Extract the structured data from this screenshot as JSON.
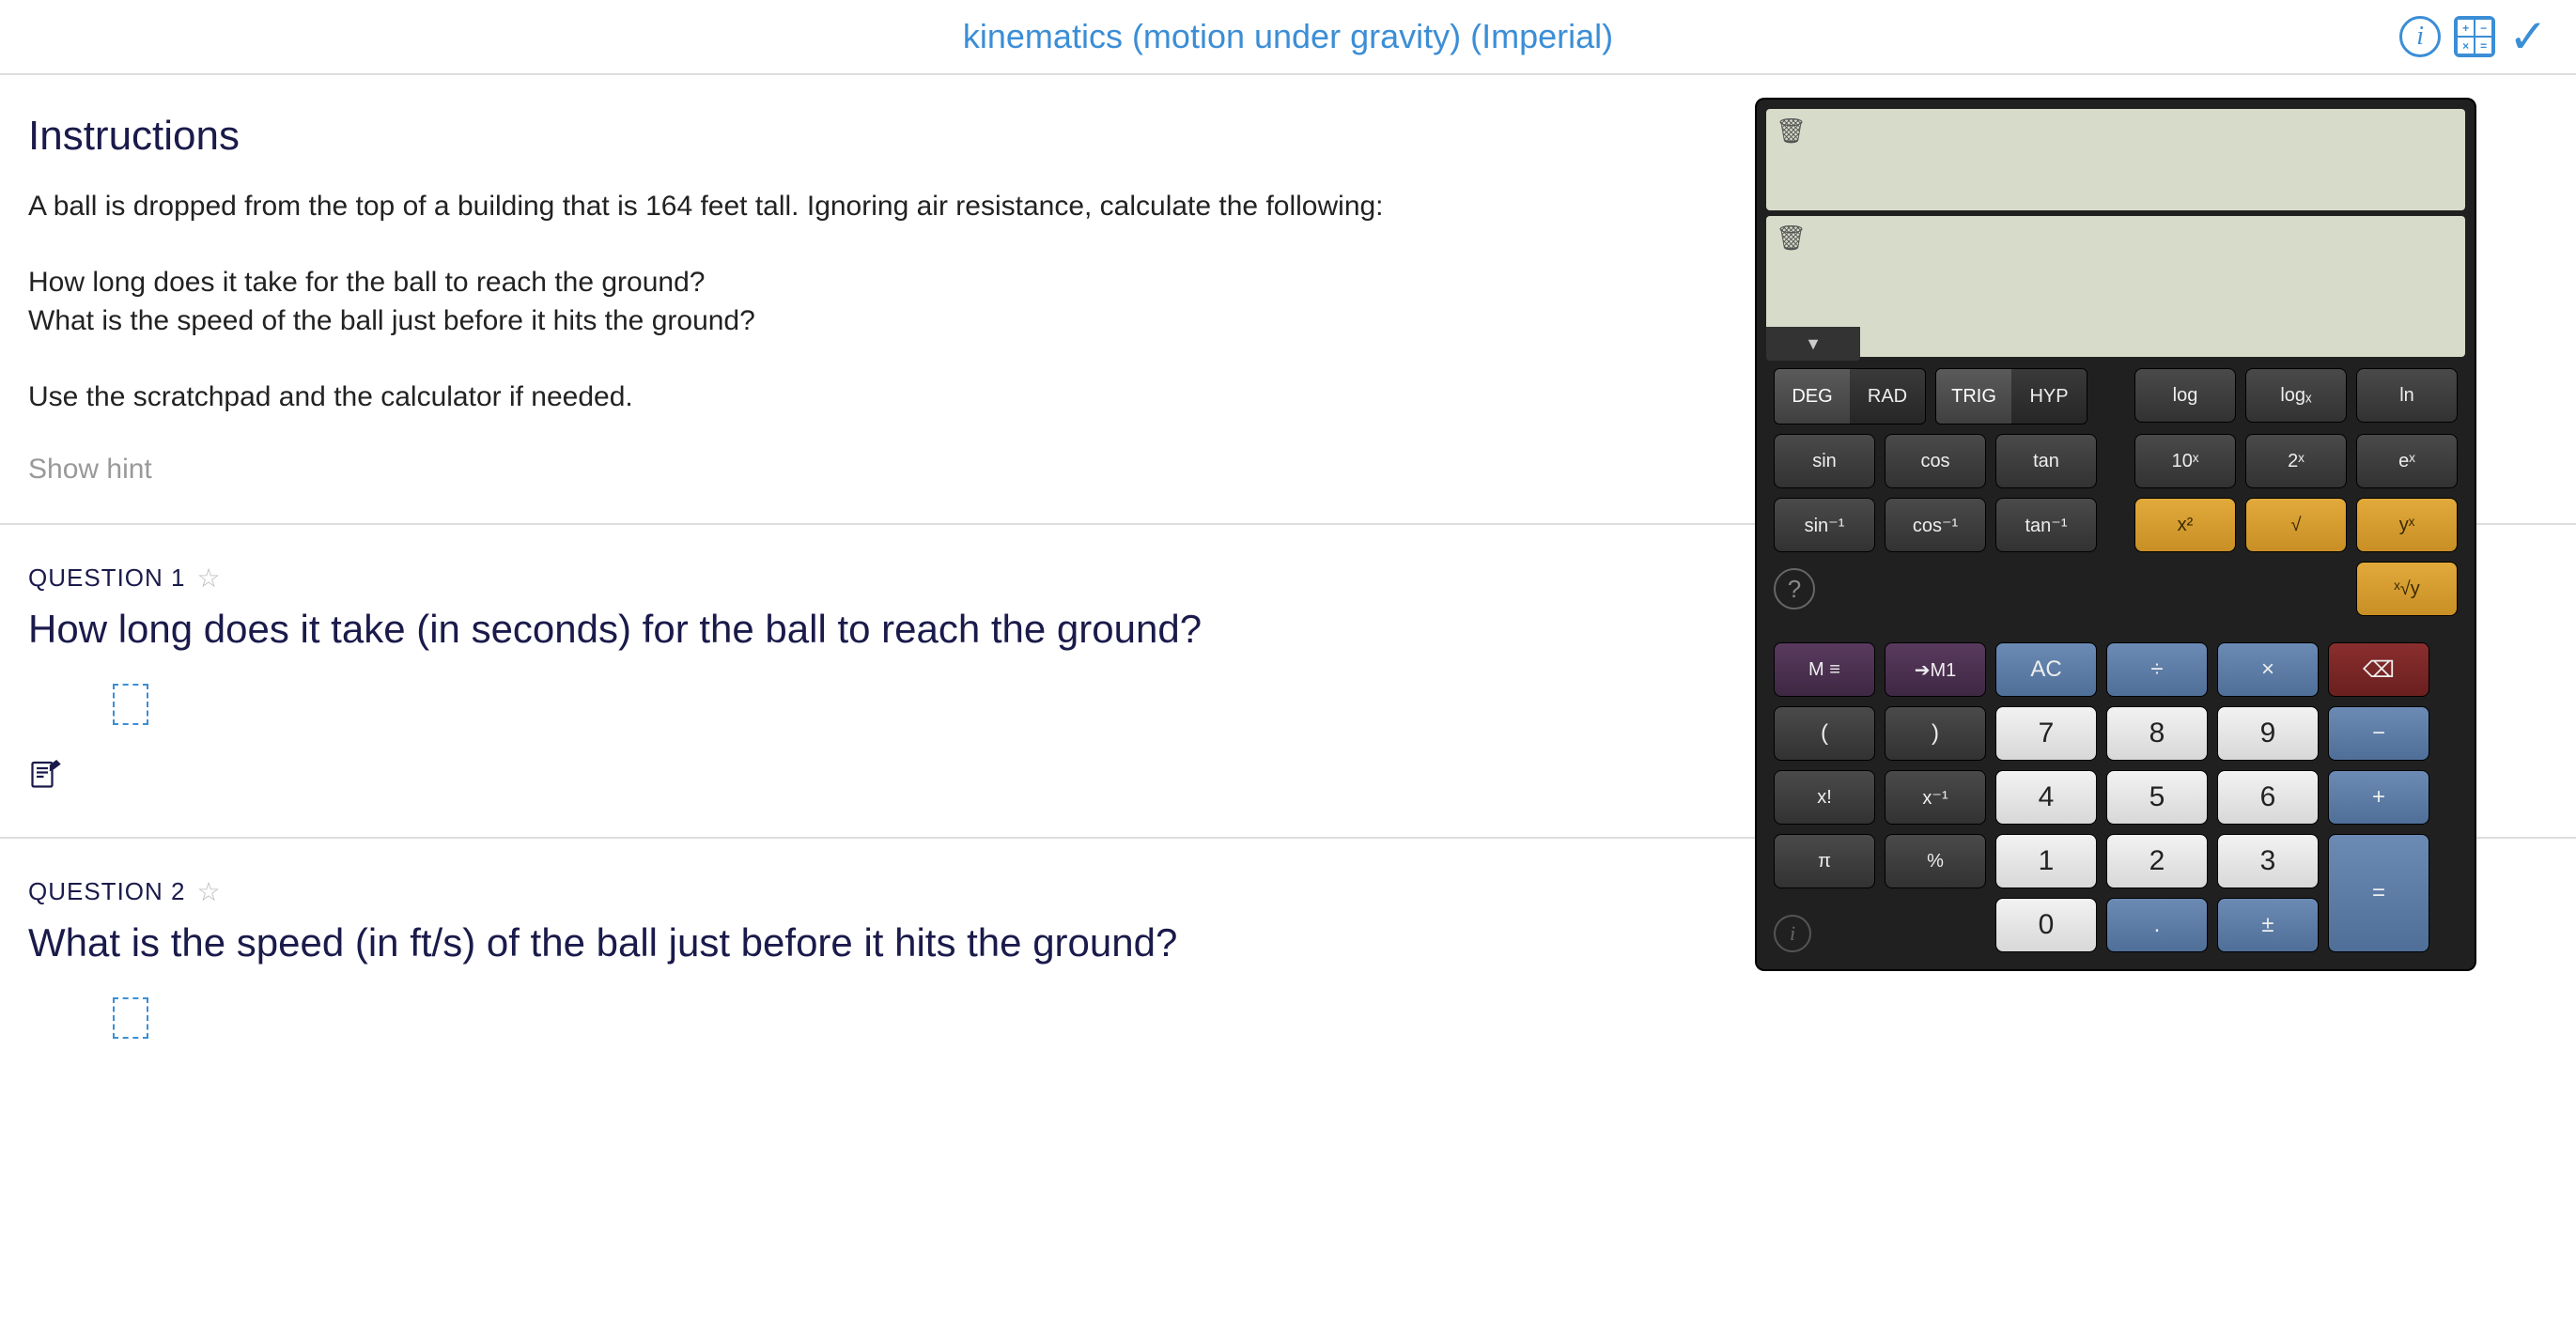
{
  "header": {
    "title": "kinematics (motion under gravity) (Imperial)"
  },
  "instructions": {
    "heading": "Instructions",
    "body": "A ball is dropped from the top of a building that is 164 feet tall. Ignoring air resistance, calculate the following:\n\nHow long does it take for the ball to reach the ground?\nWhat is the speed of the ball just before it hits the ground?\n\nUse the scratchpad and the calculator if needed.",
    "hint_label": "Show hint"
  },
  "questions": [
    {
      "label": "QUESTION 1",
      "text": "How long does it take (in seconds) for the ball to reach the ground?"
    },
    {
      "label": "QUESTION 2",
      "text": "What is the speed (in ft/s) of the ball just before it hits the ground?"
    }
  ],
  "calc": {
    "mode": {
      "deg": "DEG",
      "rad": "RAD",
      "trig": "TRIG",
      "hyp": "HYP"
    },
    "row1": {
      "log": "log",
      "logx": "logₓ",
      "ln": "ln"
    },
    "row2": {
      "sin": "sin",
      "cos": "cos",
      "tan": "tan",
      "tenx": "10ˣ",
      "twox": "2ˣ",
      "ex": "eˣ"
    },
    "row3": {
      "asin": "sin⁻¹",
      "acos": "cos⁻¹",
      "atan": "tan⁻¹",
      "x2": "x²",
      "sqrt": "√",
      "yx": "yˣ"
    },
    "row4": {
      "xrooty": "ˣ√y"
    },
    "main": {
      "mlist": "M ≡",
      "m1": "➔M1",
      "ac": "AC",
      "div": "÷",
      "mul": "×",
      "del": "⌫",
      "lp": "(",
      "rp": ")",
      "n7": "7",
      "n8": "8",
      "n9": "9",
      "minus": "−",
      "fact": "x!",
      "inv": "x⁻¹",
      "n4": "4",
      "n5": "5",
      "n6": "6",
      "plus": "+",
      "pi": "π",
      "pct": "%",
      "n1": "1",
      "n2": "2",
      "n3": "3",
      "eq": "=",
      "n0": "0",
      "dot": ".",
      "pm": "±"
    }
  }
}
